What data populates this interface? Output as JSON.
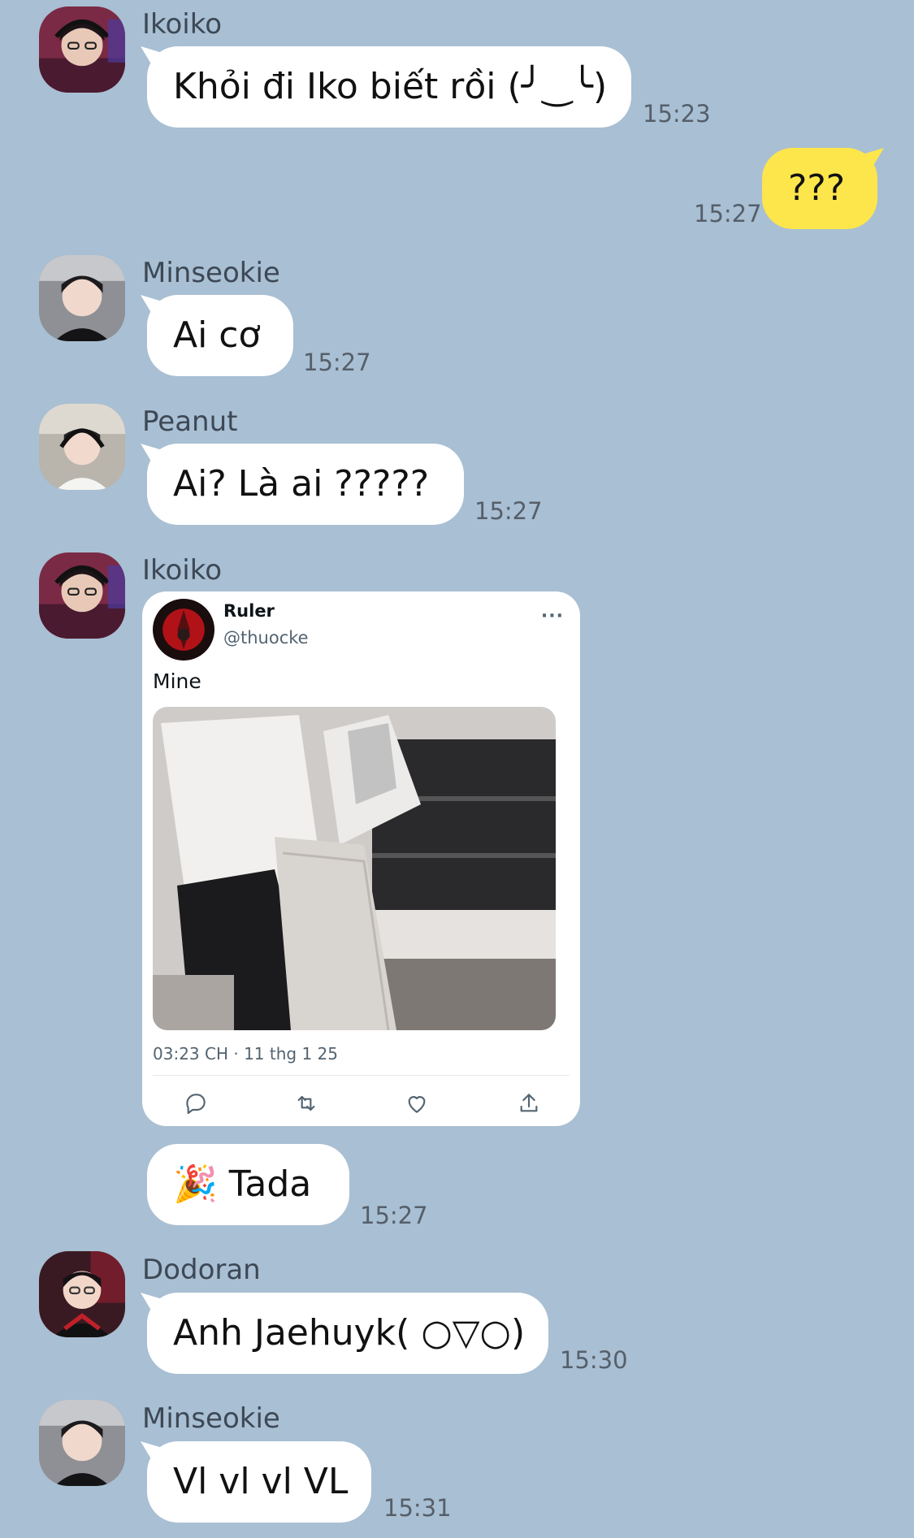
{
  "messages": [
    {
      "sender": "Ikoiko",
      "text": "Khỏi đi Iko biết rồi (╯‿╰)",
      "time": "15:23"
    },
    {
      "sender": "me",
      "text": "???",
      "time": "15:27"
    },
    {
      "sender": "Minseokie",
      "text": "Ai cơ",
      "time": "15:27"
    },
    {
      "sender": "Peanut",
      "text": "Ai? Là ai ?????",
      "time": "15:27"
    },
    {
      "sender": "Ikoiko",
      "type": "tweet"
    },
    {
      "sender": "Ikoiko",
      "text": "🎉 Tada",
      "time": "15:27"
    },
    {
      "sender": "Dodoran",
      "text": "Anh Jaehuyk( ○▽○)",
      "time": "15:30"
    },
    {
      "sender": "Minseokie",
      "text": "Vl vl vl VL",
      "time": "15:31"
    }
  ],
  "tweet": {
    "display_name": "Ruler",
    "handle": "@thuocke",
    "more_icon": "···",
    "text": "Mine",
    "date": "03:23 CH · 11 thg 1 25",
    "actions": [
      "reply-icon",
      "retweet-icon",
      "like-icon",
      "share-icon"
    ]
  },
  "colors": {
    "background": "#a9bfd3",
    "incoming_bubble": "#ffffff",
    "outgoing_bubble": "#fde64b",
    "time_text": "#555f6a",
    "name_text": "#3d4856"
  }
}
